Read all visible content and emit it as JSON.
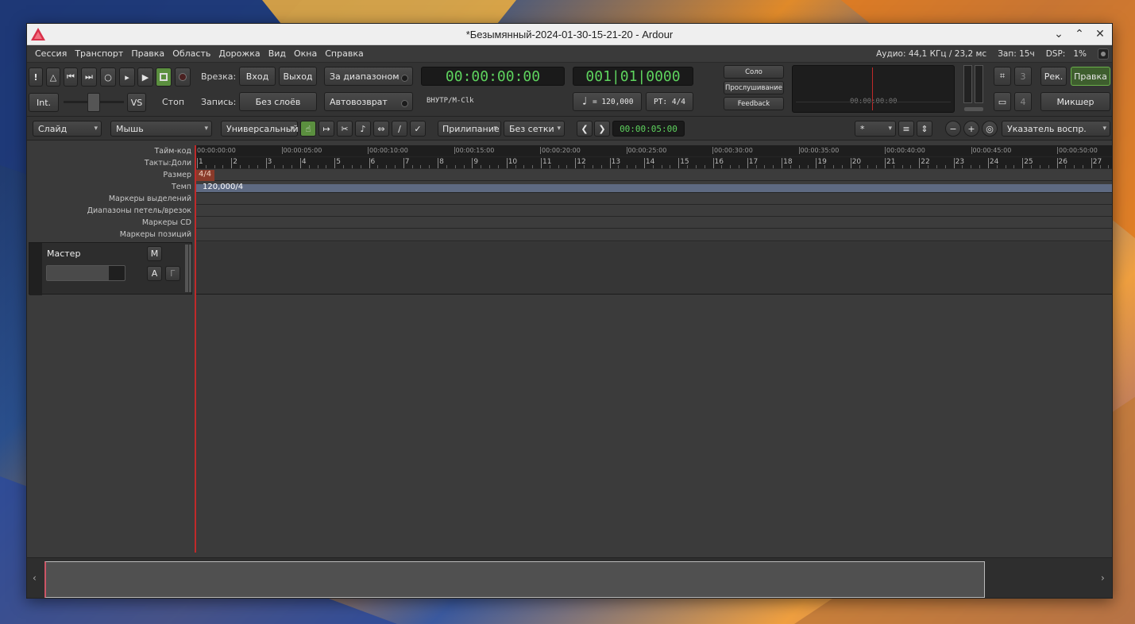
{
  "window": {
    "title": "*Безымянный-2024-01-30-15-21-20 - Ardour"
  },
  "menu": [
    "Сессия",
    "Транспорт",
    "Правка",
    "Область",
    "Дорожка",
    "Вид",
    "Окна",
    "Справка"
  ],
  "status": {
    "audio": "Аудио: 44,1 КГц / 23,2 мс",
    "rec": "Зап: 15ч",
    "dsp_label": "DSP:",
    "dsp_value": "1%"
  },
  "transport": {
    "int_label": "Int.",
    "vs_label": "VS",
    "stop_label": "Стоп",
    "punch_label": "Врезка:",
    "punch_in": "Вход",
    "punch_out": "Выход",
    "record_label": "Запись:",
    "record_mode": "Без слоёв",
    "range_button": "За диапазоном",
    "autoreturn_button": "Автовозврат"
  },
  "clocks": {
    "primary": "00:00:00:00",
    "primary_sub": "ВНУТР/M-Clk",
    "secondary": "001|01|0000",
    "tempo": "= 120,000",
    "meter": "PT: 4/4"
  },
  "monitor": {
    "solo": "Соло",
    "listen": "Прослушивание",
    "feedback": "Feedback",
    "mini_time": "00:00:00:00"
  },
  "right_buttons": {
    "rec": "Рек.",
    "edit": "Правка",
    "mixer": "Микшер",
    "num3": "3",
    "num4": "4"
  },
  "toolbar2": {
    "edit_mode": "Слайд",
    "ripple_mode": "Мышь",
    "grid_mode": "Универсальный",
    "snap": "Прилипание",
    "grid": "Без сетки",
    "nudge_clock": "00:00:05:00",
    "zoom_preset": "*",
    "zoom_focus": "Указатель воспр."
  },
  "rulers": {
    "labels": [
      "Тайм-код",
      "Такты:Доли",
      "Размер",
      "Темп",
      "Маркеры выделений",
      "Диапазоны петель/врезок",
      "Маркеры CD",
      "Маркеры позиций"
    ],
    "timecode_ticks": [
      "00:00:00:00",
      "00:00:05:00",
      "00:00:10:00",
      "00:00:15:00",
      "00:00:20:00",
      "00:00:25:00",
      "00:00:30:00",
      "00:00:35:00",
      "00:00:40:00",
      "00:00:45:00",
      "00:00:50:00"
    ],
    "bars": [
      "1",
      "2",
      "3",
      "4",
      "5",
      "6",
      "7",
      "8",
      "9",
      "10",
      "11",
      "12",
      "13",
      "14",
      "15",
      "16",
      "17",
      "18",
      "19",
      "20",
      "21",
      "22",
      "23",
      "24",
      "25",
      "26",
      "27"
    ],
    "meter_marker": "4/4",
    "tempo_marker": "120,000/4"
  },
  "master": {
    "name": "Мастер",
    "mute": "M",
    "automation": "A",
    "group": "Г"
  },
  "colors": {
    "clock_green": "#5ed35e",
    "playhead": "#c02a2a",
    "active_green": "#5b8f3f"
  }
}
